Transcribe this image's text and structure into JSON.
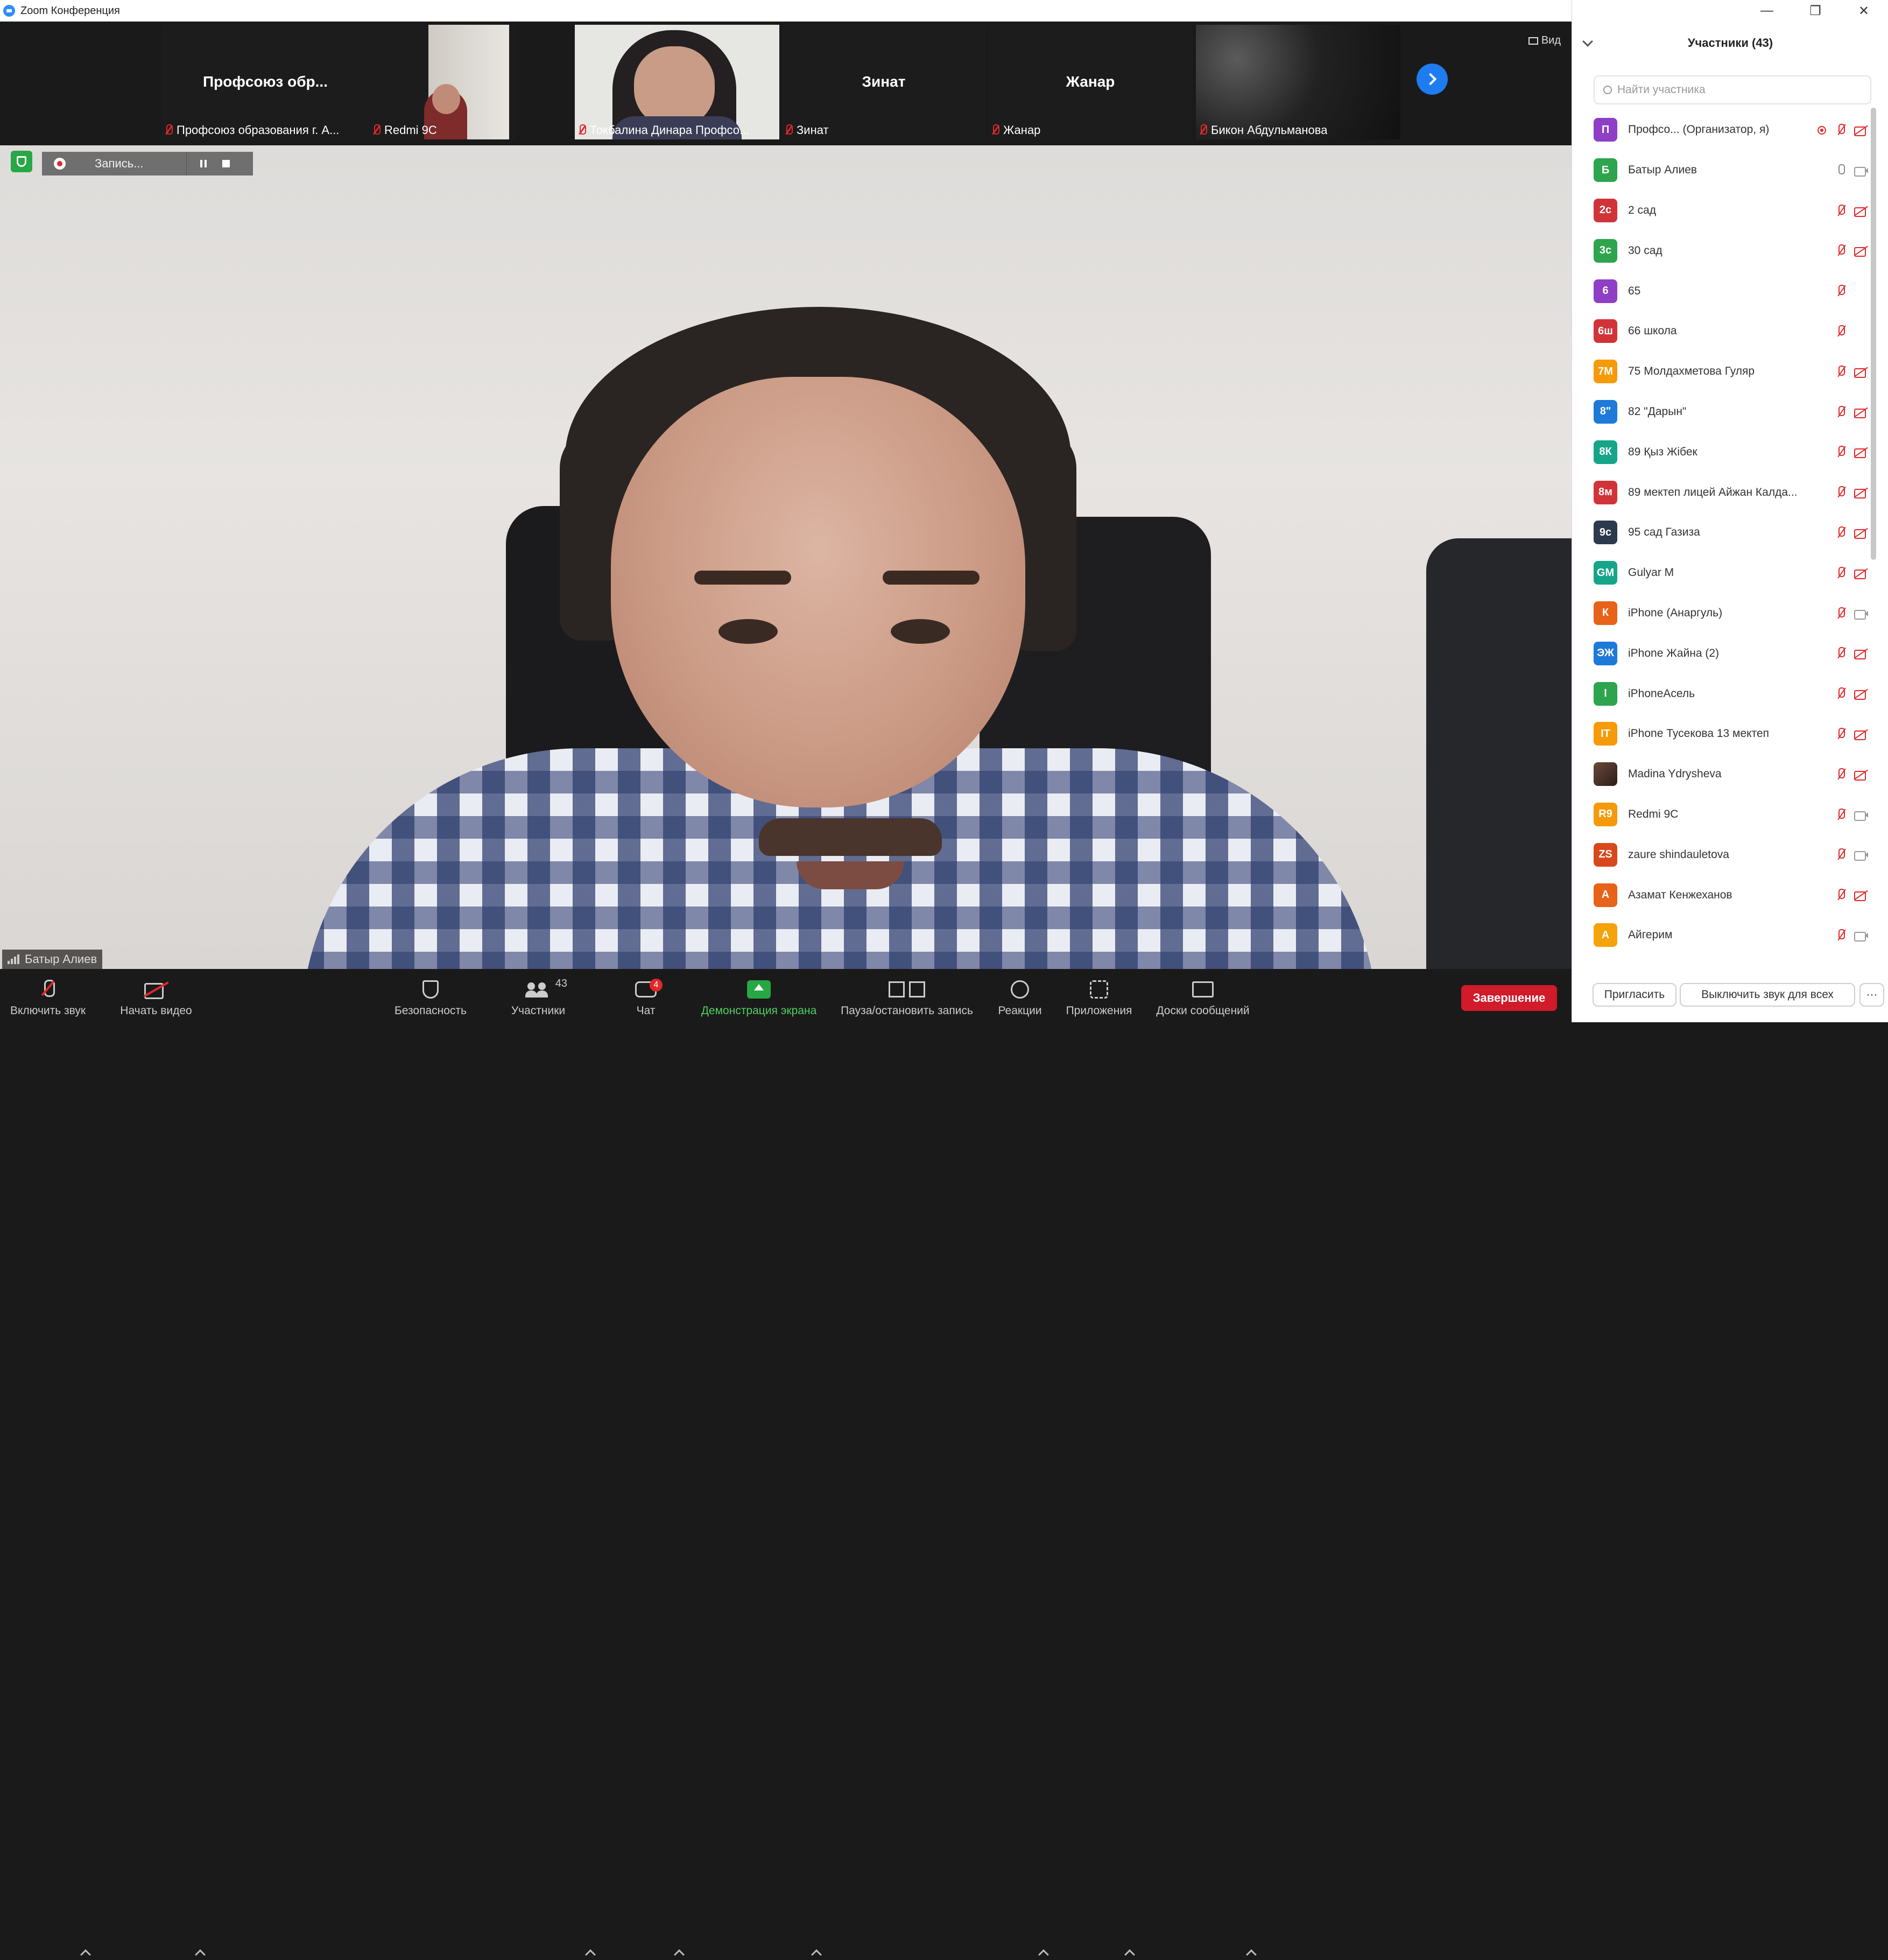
{
  "window": {
    "title": "Zoom Конференция",
    "controls": [
      "—",
      "❐",
      "✕"
    ]
  },
  "strip": {
    "thumbnails": [
      {
        "center": "Профсоюз  обр...",
        "name": "Профсоюз образования г. А..."
      },
      {
        "center": "",
        "name": "Redmi 9C"
      },
      {
        "center": "",
        "name": "Токбалина Динара Профсо..."
      },
      {
        "center": "Зинат",
        "name": "Зинат"
      },
      {
        "center": "Жанар",
        "name": "Жанар"
      },
      {
        "center": "",
        "name": "Бикон Абдульманова"
      }
    ],
    "view_label": "Вид"
  },
  "main": {
    "recording": {
      "label": "Запись..."
    },
    "speaker": "Батыр Алиев"
  },
  "toolbar": {
    "unmute": "Включить звук",
    "start_video": "Начать видео",
    "security": "Безопасность",
    "participants": "Участники",
    "participants_count": "43",
    "chat": "Чат",
    "chat_badge": "4",
    "share": "Демонстрация экрана",
    "record": "Пауза/остановить запись",
    "reactions": "Реакции",
    "apps": "Приложения",
    "boards": "Доски сообщений",
    "end": "Завершение"
  },
  "colors": {
    "accent": "#2d8cff",
    "share_green": "#27a745",
    "end_red": "#d11a2a",
    "muted_red": "#e02828",
    "share_label": "#4fd060"
  },
  "panel": {
    "title": "Участники (43)",
    "search_placeholder": "Найти участника",
    "participants": [
      {
        "initials": "П",
        "color": "#8e3fc5",
        "name": "Профсо...  (Организатор, я)",
        "mic": "off",
        "video": "off",
        "host": true
      },
      {
        "initials": "Б",
        "color": "#2ea44f",
        "name": "Батыр Алиев",
        "mic": "on",
        "video": "on"
      },
      {
        "initials": "2с",
        "color": "#d13438",
        "name": "2 сад",
        "mic": "off",
        "video": "off"
      },
      {
        "initials": "3с",
        "color": "#2ea44f",
        "name": "30 сад",
        "mic": "off",
        "video": "off"
      },
      {
        "initials": "6",
        "color": "#8e3fc5",
        "name": "65",
        "mic": "off",
        "video": "none"
      },
      {
        "initials": "6ш",
        "color": "#d13438",
        "name": "66 школа",
        "mic": "off",
        "video": "none"
      },
      {
        "initials": "7М",
        "color": "#f59b0b",
        "name": "75 Молдахметова Гуляр",
        "mic": "off",
        "video": "off"
      },
      {
        "initials": "8\"",
        "color": "#1e7ad9",
        "name": "82 \"Дарын\"",
        "mic": "off",
        "video": "off"
      },
      {
        "initials": "8К",
        "color": "#17a589",
        "name": "89 Қыз Жібек",
        "mic": "off",
        "video": "off"
      },
      {
        "initials": "8м",
        "color": "#d13438",
        "name": "89 мектеп лицей Айжан Калда...",
        "mic": "off",
        "video": "off"
      },
      {
        "initials": "9с",
        "color": "#2b3a4d",
        "name": "95 сад Газиза",
        "mic": "off",
        "video": "off"
      },
      {
        "initials": "GM",
        "color": "#17a589",
        "name": "Gulyar M",
        "mic": "off",
        "video": "off"
      },
      {
        "initials": "К",
        "color": "#e8621a",
        "name": "iPhone (Анаргуль)",
        "mic": "off",
        "video": "on"
      },
      {
        "initials": "ЭЖ",
        "color": "#1e7ad9",
        "name": "iPhone Жайна (2)",
        "mic": "off",
        "video": "off"
      },
      {
        "initials": "I",
        "color": "#2ea44f",
        "name": "iPhoneАсель",
        "mic": "off",
        "video": "off"
      },
      {
        "initials": "IT",
        "color": "#f59b0b",
        "name": "iPhone Тусекова 13 мектеп",
        "mic": "off",
        "video": "off"
      },
      {
        "initials": "",
        "color": "#5a3d31",
        "name": "Madina Ydrysheva",
        "mic": "off",
        "video": "off",
        "photo": true
      },
      {
        "initials": "R9",
        "color": "#f59b0b",
        "name": "Redmi 9C",
        "mic": "off",
        "video": "on"
      },
      {
        "initials": "ZS",
        "color": "#d9481c",
        "name": "zaure shindauletova",
        "mic": "off",
        "video": "on"
      },
      {
        "initials": "А",
        "color": "#e8621a",
        "name": "Азамат Кенжеханов",
        "mic": "off",
        "video": "off"
      },
      {
        "initials": "А",
        "color": "#f5a30b",
        "name": "Айгерим",
        "mic": "off",
        "video": "on"
      }
    ],
    "footer": {
      "invite": "Пригласить",
      "mute_all": "Выключить звук для всех",
      "more": "···"
    }
  }
}
